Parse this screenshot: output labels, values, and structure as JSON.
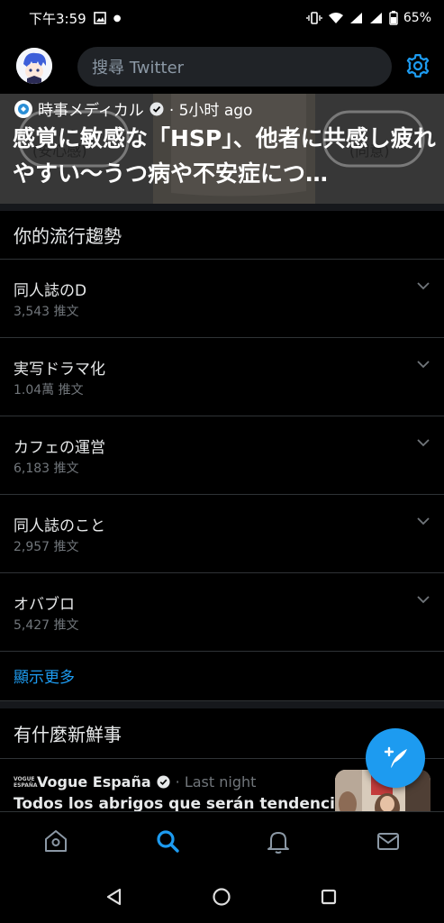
{
  "status_bar": {
    "time": "下午3:59",
    "battery": "65%"
  },
  "topbar": {
    "search_placeholder": "搜尋 Twitter"
  },
  "featured": {
    "source": "時事メディカル",
    "time": "· 5小时 ago",
    "title": "感覚に敏感な「HSP」、他者に共感し疲れやすい〜うつ病や不安症につ…",
    "art_label_left": "(安心感)",
    "art_label_right": "(同意)"
  },
  "trends_section": {
    "heading": "你的流行趨勢",
    "items": [
      {
        "title": "同人誌のD",
        "count": "3,543 推文"
      },
      {
        "title": "実写ドラマ化",
        "count": "1.04萬 推文"
      },
      {
        "title": "カフェの運営",
        "count": "6,183 推文"
      },
      {
        "title": "同人誌のこと",
        "count": "2,957 推文"
      },
      {
        "title": "オバブロ",
        "count": "5,427 推文"
      }
    ],
    "show_more": "顯示更多"
  },
  "news_section": {
    "heading": "有什麼新鮮事",
    "item": {
      "source": "Vogue España",
      "logo_text": "VOGUE ESPAÑA",
      "time": "· Last night",
      "title": "Todos los abrigos que serán tendencia"
    }
  },
  "colors": {
    "accent": "#1d9bf0",
    "background": "#000000",
    "search_bg": "#202327",
    "divider": "#2f3336",
    "muted_text": "#71767b"
  },
  "icons": {
    "settings": "gear-icon",
    "home": "home-icon",
    "search": "search-icon",
    "notifications": "bell-icon",
    "messages": "mail-icon",
    "compose": "compose-tweet-icon",
    "verified": "verified-badge-icon",
    "trend_menu": "chevron-down-icon"
  }
}
